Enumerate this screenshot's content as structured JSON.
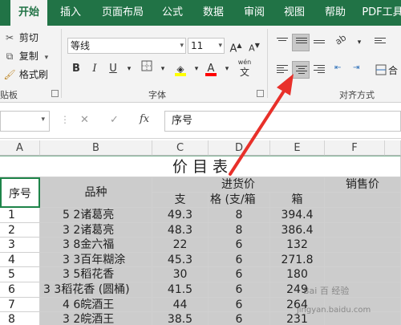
{
  "tabs": [
    "开始",
    "插入",
    "页面布局",
    "公式",
    "数据",
    "审阅",
    "视图",
    "帮助",
    "PDF工具"
  ],
  "clipboard": {
    "cut": "剪切",
    "copy": "复制",
    "format_painter": "格式刷",
    "group_label": "贴板"
  },
  "font": {
    "name": "等线",
    "size": "11",
    "bold": "B",
    "italic": "I",
    "underline": "U",
    "font_color_letter": "A",
    "wen": "wén",
    "wen_char": "文",
    "group_label": "字体",
    "highlight_color": "#ffff00",
    "font_color": "#ff0000"
  },
  "alignment": {
    "group_label": "对齐方式",
    "merge_label": "合"
  },
  "formula_bar": {
    "fx": "fx",
    "cancel": "✕",
    "enter": "✓",
    "content": "序号"
  },
  "columns": [
    "A",
    "B",
    "C",
    "D",
    "E",
    "F"
  ],
  "sheet": {
    "title": "价 目 表",
    "hdr_no": "序号",
    "hdr_name": "品种",
    "hdr_purchase": "进货价",
    "hdr_sale": "销售价",
    "sub_unit": "支",
    "sub_spec": "格 (支/箱",
    "sub_box": "箱",
    "rows": [
      {
        "no": "1",
        "name": "5 2诸葛亮",
        "unit": "49.3",
        "spec": "8",
        "box": "394.4"
      },
      {
        "no": "2",
        "name": "3 2诸葛亮",
        "unit": "48.3",
        "spec": "8",
        "box": "386.4"
      },
      {
        "no": "3",
        "name": "3 8金六福",
        "unit": "22",
        "spec": "6",
        "box": "132"
      },
      {
        "no": "4",
        "name": "3 3百年糊涂",
        "unit": "45.3",
        "spec": "6",
        "box": "271.8"
      },
      {
        "no": "5",
        "name": "3 5稻花香",
        "unit": "30",
        "spec": "6",
        "box": "180"
      },
      {
        "no": "6",
        "name": "3 3稻花香 (圆桶)",
        "unit": "41.5",
        "spec": "6",
        "box": "249"
      },
      {
        "no": "7",
        "name": "4 6皖酒王",
        "unit": "44",
        "spec": "6",
        "box": "264"
      },
      {
        "no": "8",
        "name": "3 2皖酒王",
        "unit": "38.5",
        "spec": "6",
        "box": "231"
      }
    ]
  },
  "watermark": {
    "line1": "Bai 百 经验",
    "line2": "jingyan.baidu.com"
  },
  "colors": {
    "accent": "#217346",
    "arrow": "#e8302a",
    "cell_gray": "#cccccc"
  }
}
